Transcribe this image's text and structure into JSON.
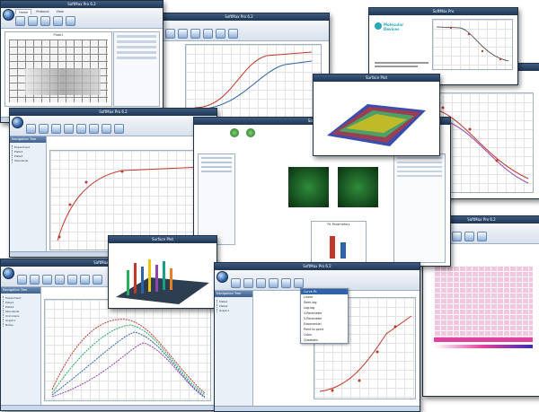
{
  "app": {
    "title": "SoftMax Pro 6.2",
    "window_title_short": "SoftMax Pro",
    "brand_line1": "Molecular",
    "brand_line2": "Devices"
  },
  "ribbon": {
    "tabs": [
      "Home",
      "Protocol",
      "View",
      "Operations",
      "Help"
    ]
  },
  "navigation": {
    "header": "Navigation Tree",
    "items": [
      "Experiment",
      "Plate1",
      "Plate2",
      "Standards",
      "Unknowns",
      "Graph1",
      "Notes"
    ]
  },
  "main": {
    "plate_title": "Plate1",
    "result_label": "Results",
    "graph_title": "Absorbance Scan",
    "menu_items": [
      "Curve Fit",
      "Linear",
      "Semi-log",
      "Log-log",
      "4-Parameter",
      "5-Parameter",
      "Exponential",
      "Point to point",
      "Cubic",
      "Quadratic"
    ],
    "fit_panel_title": "Fit Parameters",
    "dialog_title": "Surface Plot"
  },
  "colors": {
    "titlebar": "#1e3554",
    "ribbon": "#d8e1ec",
    "accent_red": "#c0392b",
    "accent_blue": "#2f63a8",
    "heatmap_pink": "#e040a0",
    "cell_green": "#1f6b2a"
  },
  "icons": [
    "application-orb-icon",
    "ribbon-button-icon",
    "tree-node-icon"
  ]
}
